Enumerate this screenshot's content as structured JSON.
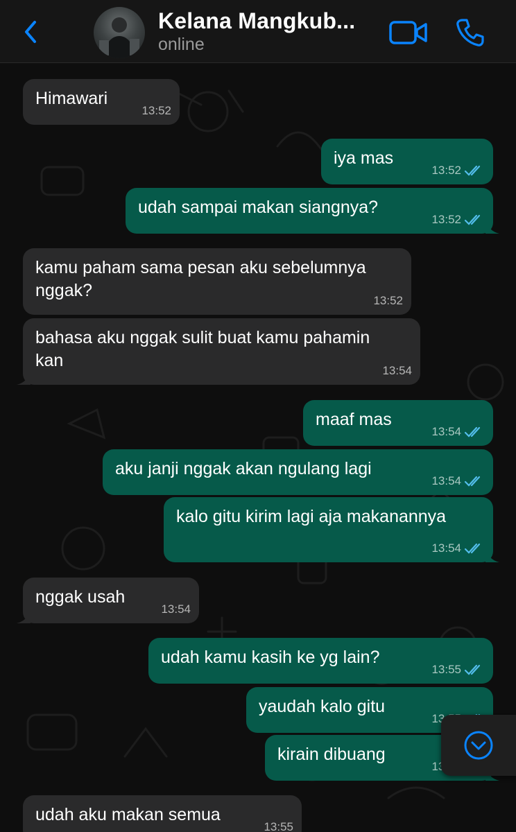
{
  "header": {
    "contact_name": "Kelana Mangkub...",
    "status": "online"
  },
  "icons": {
    "back": "chevron-left-icon",
    "video": "video-camera-icon",
    "call": "phone-icon",
    "scroll_down": "chevron-down-circle-icon",
    "read_receipt": "double-check-icon"
  },
  "colors": {
    "accent": "#0a84ff",
    "incoming_bubble": "#2a2a2b",
    "outgoing_bubble": "#065a4a",
    "read_ticks": "#53bdeb",
    "background": "#0e0e0e"
  },
  "messages": [
    {
      "dir": "in",
      "text": "Himawari",
      "time": "13:52"
    },
    {
      "dir": "out",
      "text": "iya mas",
      "time": "13:52",
      "read": true
    },
    {
      "dir": "out",
      "text": "udah sampai makan siangnya?",
      "time": "13:52",
      "read": true
    },
    {
      "dir": "in",
      "text": "kamu paham sama pesan aku sebelumnya\nnggak?",
      "time": "13:52"
    },
    {
      "dir": "in",
      "text": "bahasa aku nggak sulit buat kamu pahamin\nkan",
      "time": "13:54"
    },
    {
      "dir": "out",
      "text": "maaf mas",
      "time": "13:54",
      "read": true
    },
    {
      "dir": "out",
      "text": "aku janji nggak akan ngulang lagi",
      "time": "13:54",
      "read": true
    },
    {
      "dir": "out",
      "text": "kalo gitu kirim lagi aja makanannya",
      "time": "13:54",
      "read": true
    },
    {
      "dir": "in",
      "text": "nggak usah",
      "time": "13:54"
    },
    {
      "dir": "out",
      "text": "udah kamu kasih ke yg lain?",
      "time": "13:55",
      "read": true
    },
    {
      "dir": "out",
      "text": "yaudah kalo gitu",
      "time": "13:55",
      "read": true
    },
    {
      "dir": "out",
      "text": "kirain dibuang",
      "time": "13:55",
      "read": true
    },
    {
      "dir": "in",
      "text": "udah aku makan semua",
      "time": "13:55"
    }
  ]
}
